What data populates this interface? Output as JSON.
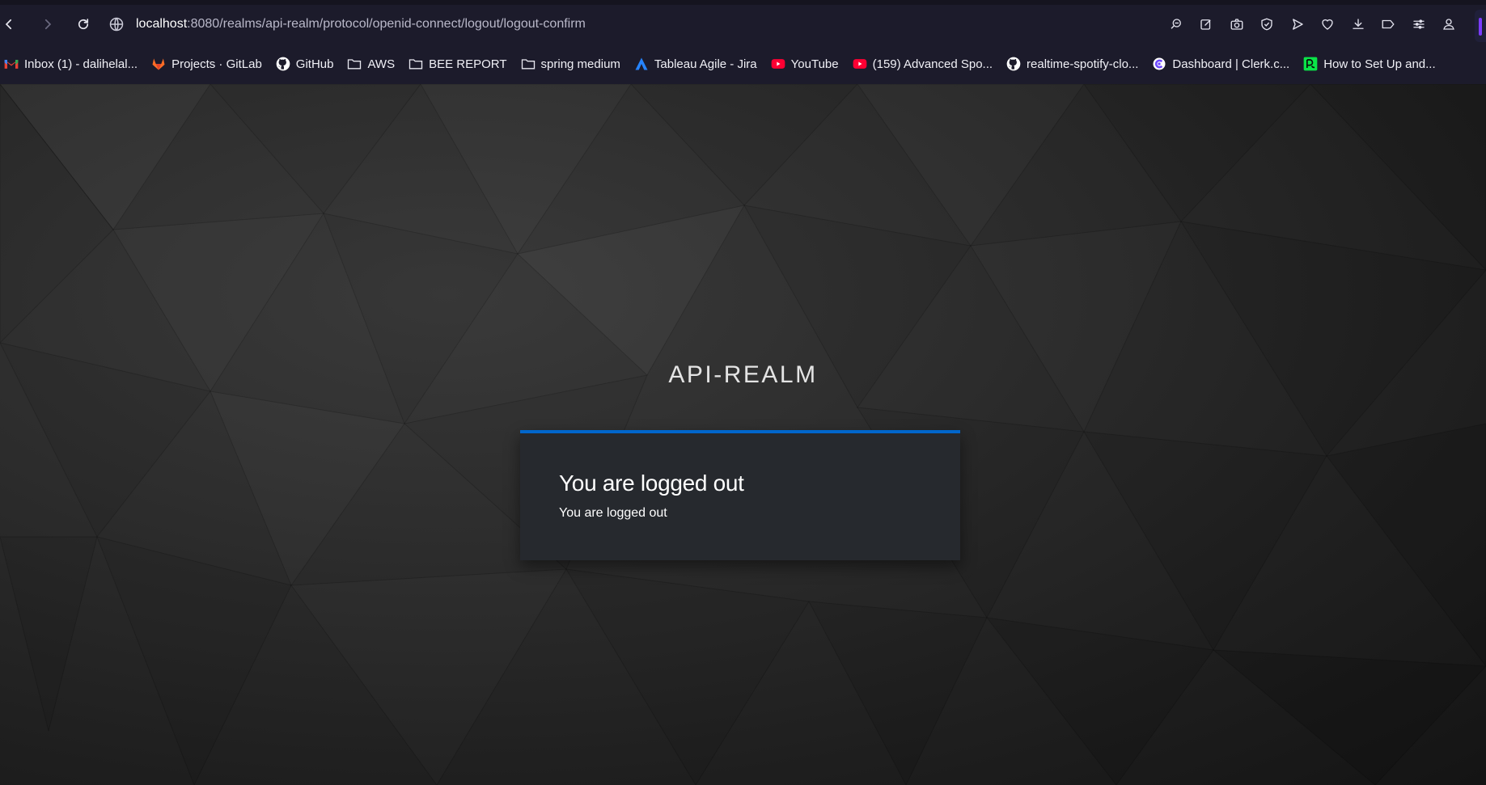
{
  "browser": {
    "url": {
      "host": "localhost",
      "rest": ":8080/realms/api-realm/protocol/openid-connect/logout/logout-confirm"
    },
    "nav_icons": [
      "back-icon",
      "forward-icon",
      "reload-icon",
      "globe-icon"
    ],
    "toolbar_icons": [
      "search-tabs-icon",
      "edit-icon",
      "camera-icon",
      "shield-icon",
      "send-icon",
      "heart-icon",
      "download-icon",
      "tag-icon",
      "settings-sliders-icon",
      "profile-icon"
    ],
    "bookmarks": [
      {
        "label": "Inbox (1) - dalihelal...",
        "icon": "gmail-icon"
      },
      {
        "label": "Projects · GitLab",
        "icon": "gitlab-icon"
      },
      {
        "label": "GitHub",
        "icon": "github-icon"
      },
      {
        "label": "AWS",
        "icon": "folder-icon"
      },
      {
        "label": "BEE REPORT",
        "icon": "folder-icon"
      },
      {
        "label": "spring medium",
        "icon": "folder-icon"
      },
      {
        "label": "Tableau Agile - Jira",
        "icon": "jira-icon"
      },
      {
        "label": "YouTube",
        "icon": "youtube-icon"
      },
      {
        "label": "(159) Advanced Spo...",
        "icon": "youtube-icon"
      },
      {
        "label": "realtime-spotify-clo...",
        "icon": "github-icon"
      },
      {
        "label": "Dashboard | Clerk.c...",
        "icon": "clerk-icon"
      },
      {
        "label": "How to Set Up and...",
        "icon": "dc-icon"
      }
    ]
  },
  "page": {
    "realm_title": "API-REALM",
    "card": {
      "heading": "You are logged out",
      "message": "You are logged out",
      "accent_color": "#0066cc"
    }
  }
}
